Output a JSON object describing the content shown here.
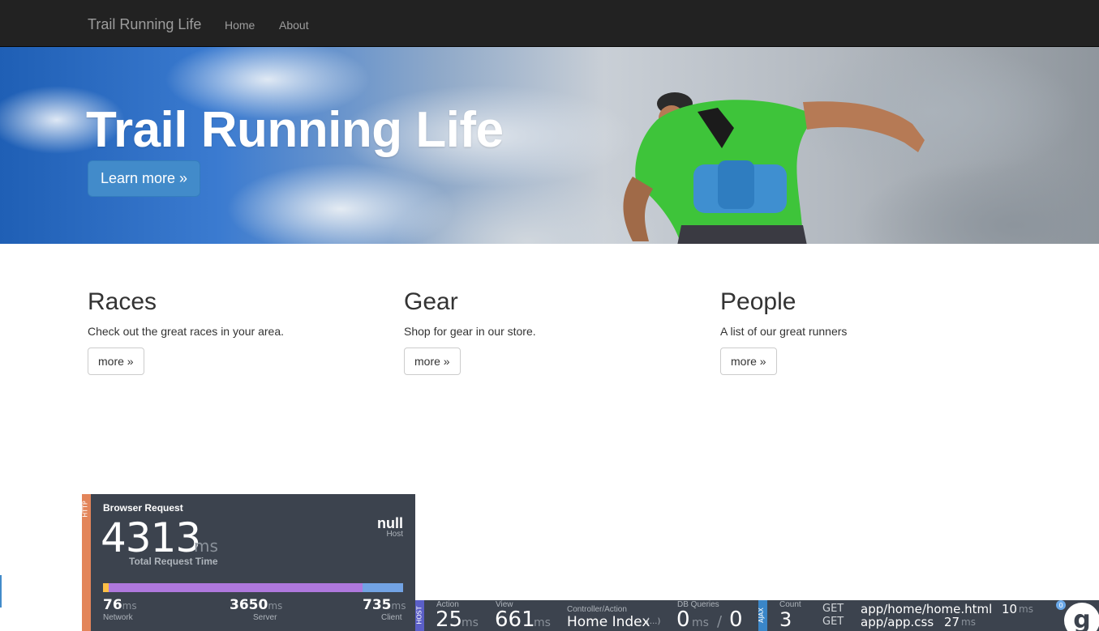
{
  "navbar": {
    "brand": "Trail Running Life",
    "links": [
      "Home",
      "About"
    ]
  },
  "hero": {
    "title": "Trail Running Life",
    "button": "Learn more »"
  },
  "columns": [
    {
      "heading": "Races",
      "text": "Check out the great races in your area.",
      "button": "more »"
    },
    {
      "heading": "Gear",
      "text": "Shop for gear in our store.",
      "button": "more »"
    },
    {
      "heading": "People",
      "text": "A list of our great runners",
      "button": "more »"
    }
  ],
  "glimpse_popup": {
    "strip_label": "HTTP",
    "title": "Browser Request",
    "total": "4313",
    "total_unit": "ms",
    "total_label": "Total Request Time",
    "host_value": "null",
    "host_label": "Host",
    "bar_fractions": {
      "network": 0.018,
      "server": 0.846,
      "client": 0.136
    },
    "bar_colors": {
      "network": "#fdbf45",
      "server": "#af78dd",
      "client": "#72a3e4"
    },
    "network": "76",
    "network_label": "Network",
    "server": "3650",
    "server_label": "Server",
    "client": "735",
    "client_label": "Client",
    "unit": "ms"
  },
  "glimpse_bar": {
    "host_tag": "HOST",
    "action_label": "Action",
    "action_value": "25",
    "action_unit": "ms",
    "view_label": "View",
    "view_value": "661",
    "view_unit": "ms",
    "controller_label": "Controller/Action",
    "controller_value": "Home Index",
    "controller_more": "(...)",
    "db_label": "DB Queries",
    "db_value": "0",
    "db_unit": "ms",
    "db_sep": "/",
    "db_count": "0",
    "ajax_tag": "AJAX",
    "count_label": "Count",
    "count_value": "3",
    "requests": [
      {
        "method": "GET",
        "url": "app/home/home.html",
        "time": "10",
        "unit": "ms"
      },
      {
        "method": "GET",
        "url": "app/app.css",
        "time": "27",
        "unit": "ms"
      }
    ],
    "logo_badge": "0",
    "colors": {
      "host_tag": "#5b5fc7",
      "ajax_tag": "#3a86c8"
    }
  }
}
